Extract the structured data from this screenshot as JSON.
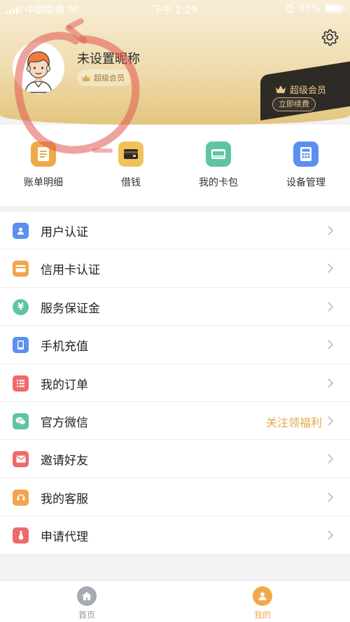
{
  "status_bar": {
    "carrier": "中国联通",
    "time": "下午 2:29",
    "battery": "95%",
    "battery_level": 0.95
  },
  "profile": {
    "nickname": "未设置昵称",
    "member_badge": "超级会员"
  },
  "vip_card": {
    "title": "超级会员",
    "renew_button": "立即续费"
  },
  "quick_actions": [
    {
      "label": "账单明细",
      "icon": "bill-icon",
      "color": "#f0a94a"
    },
    {
      "label": "借钱",
      "icon": "wallet-card-icon",
      "color": "#f2c15a"
    },
    {
      "label": "我的卡包",
      "icon": "card-pack-icon",
      "color": "#5ec4a3"
    },
    {
      "label": "设备管理",
      "icon": "calculator-icon",
      "color": "#5b8ff0"
    }
  ],
  "menu": [
    {
      "label": "用户认证",
      "icon": "user-id-icon",
      "color": "#5b8ff0"
    },
    {
      "label": "信用卡认证",
      "icon": "credit-card-icon",
      "color": "#f2a54d"
    },
    {
      "label": "服务保证金",
      "icon": "yen-icon",
      "color": "#5ec4a3"
    },
    {
      "label": "手机充值",
      "icon": "phone-icon",
      "color": "#5b8ff0"
    },
    {
      "label": "我的订单",
      "icon": "order-list-icon",
      "color": "#ee6a6a"
    },
    {
      "label": "官方微信",
      "icon": "wechat-icon",
      "color": "#5ec4a3",
      "extra": "关注领福利"
    },
    {
      "label": "邀请好友",
      "icon": "envelope-icon",
      "color": "#ee6a6a"
    },
    {
      "label": "我的客服",
      "icon": "headset-icon",
      "color": "#f2a54d"
    },
    {
      "label": "申请代理",
      "icon": "tie-icon",
      "color": "#ee6a6a"
    }
  ],
  "tab_bar": {
    "home": "首页",
    "mine": "我的",
    "active": "mine",
    "active_color": "#f0a94a",
    "inactive_color": "#999999"
  }
}
